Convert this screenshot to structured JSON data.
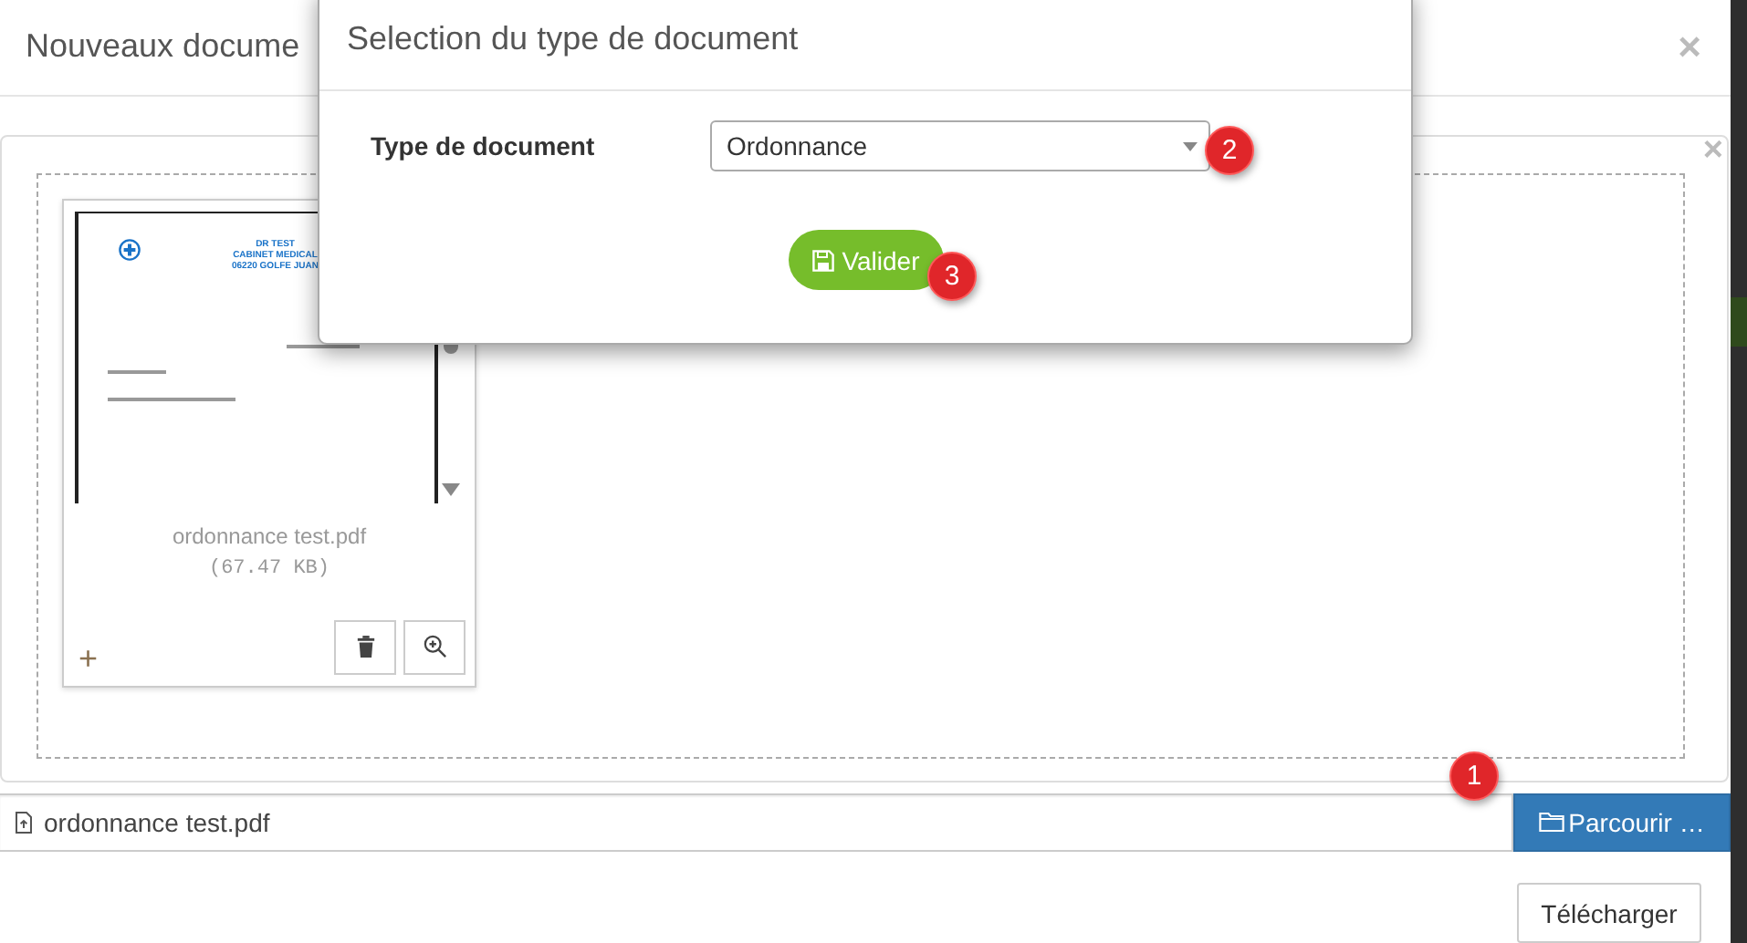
{
  "window": {
    "title": "Nouveaux docume",
    "close": "×"
  },
  "upload_panel": {
    "close": "×",
    "files": [
      {
        "letterhead": [
          "DR TEST",
          "CABINET MEDICAL",
          "06220 GOLFE JUAN"
        ],
        "name": "ordonnance test.pdf",
        "size": "(67.47 KB)",
        "add": "+"
      }
    ]
  },
  "file_input": {
    "value": "ordonnance test.pdf",
    "browse_button": "Parcourir …"
  },
  "upload_button": "Télécharger",
  "dialog": {
    "title": "Selection du type de document",
    "field_label": "Type de document",
    "select_value": "Ordonnance",
    "submit_button": "Valider"
  },
  "callouts": [
    {
      "number": "1"
    },
    {
      "number": "2"
    },
    {
      "number": "3"
    }
  ]
}
